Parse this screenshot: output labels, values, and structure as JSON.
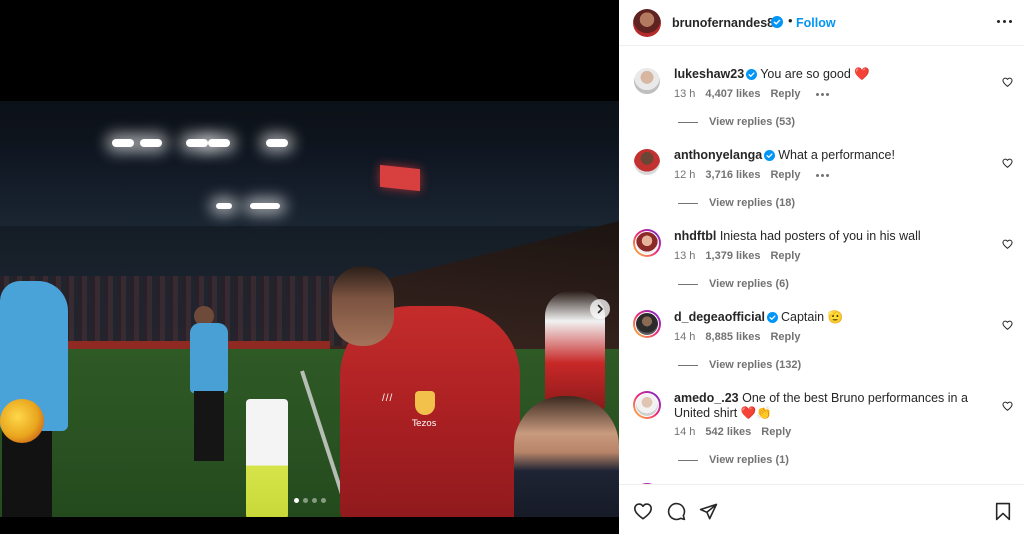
{
  "header": {
    "username": "brunofernandes8",
    "separator": "•",
    "follow_label": "Follow"
  },
  "photo": {
    "sponsor_text": "Tezos",
    "carousel_count": 4,
    "carousel_active": 1
  },
  "comments": [
    {
      "username": "lukeshaw23",
      "verified": true,
      "text": "You are so good ❤️",
      "time": "13 h",
      "likes": "4,407 likes",
      "reply": "Reply",
      "view_replies": "View replies (53)",
      "ring": false
    },
    {
      "username": "anthonyelanga",
      "verified": true,
      "text": "What a performance!",
      "time": "12 h",
      "likes": "3,716 likes",
      "reply": "Reply",
      "view_replies": "View replies (18)",
      "ring": false
    },
    {
      "username": "nhdftbl",
      "verified": false,
      "text": "Iniesta had posters of you in his wall",
      "time": "13 h",
      "likes": "1,379 likes",
      "reply": "Reply",
      "view_replies": "View replies (6)",
      "ring": true
    },
    {
      "username": "d_degeaofficial",
      "verified": true,
      "text": "Captain 🫡",
      "time": "14 h",
      "likes": "8,885 likes",
      "reply": "Reply",
      "view_replies": "View replies (132)",
      "ring": true
    },
    {
      "username": "amedo_.23",
      "verified": false,
      "text": "One of the best Bruno performances in a United shirt ❤️👏",
      "time": "14 h",
      "likes": "542 likes",
      "reply": "Reply",
      "view_replies": "View replies (1)",
      "ring": true
    }
  ],
  "icons": {
    "verified": "verified-badge-icon",
    "like": "heart-icon",
    "comment": "comment-icon",
    "share": "send-icon",
    "save": "bookmark-icon",
    "more": "more-icon",
    "next": "chevron-right-icon"
  },
  "colors": {
    "accent": "#0095f6",
    "text": "#262626",
    "secondary": "#737373",
    "border": "#efefef"
  }
}
